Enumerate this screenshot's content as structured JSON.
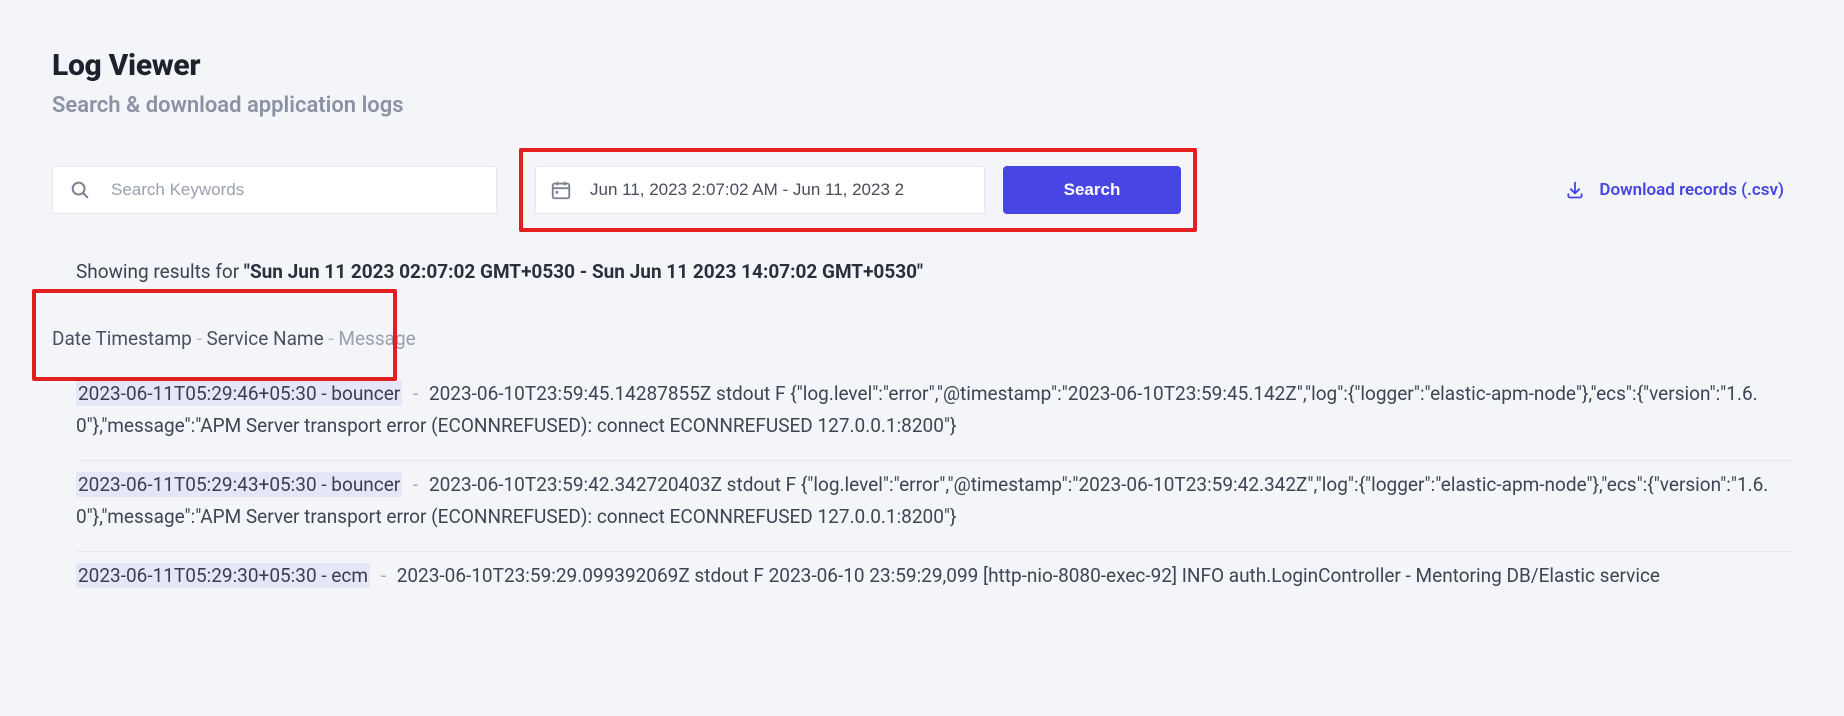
{
  "page": {
    "title": "Log Viewer",
    "subtitle": "Search & download application logs"
  },
  "search": {
    "placeholder": "Search Keywords",
    "value": ""
  },
  "dateRange": {
    "value": "Jun 11, 2023 2:07:02 AM - Jun 11, 2023 2"
  },
  "searchButton": "Search",
  "download": {
    "label": "Download records (.csv)"
  },
  "results": {
    "showingPrefix": "Showing results for ",
    "rangeText": "\"Sun Jun 11 2023 02:07:02 GMT+0530 - Sun Jun 11 2023 14:07:02 GMT+0530\"",
    "columns": {
      "timestamp": "Date Timestamp",
      "service": "Service Name",
      "message": "Message"
    },
    "logs": [
      {
        "prefix": "2023-06-11T05:29:46+05:30 - bouncer",
        "body": "2023-06-10T23:59:45.14287855Z stdout F {\"log.level\":\"error\",\"@timestamp\":\"2023-06-10T23:59:45.142Z\",\"log\":{\"logger\":\"elastic-apm-node\"},\"ecs\":{\"version\":\"1.6.0\"},\"message\":\"APM Server transport error (ECONNREFUSED): connect ECONNREFUSED 127.0.0.1:8200\"}"
      },
      {
        "prefix": "2023-06-11T05:29:43+05:30 - bouncer",
        "body": "2023-06-10T23:59:42.342720403Z stdout F {\"log.level\":\"error\",\"@timestamp\":\"2023-06-10T23:59:42.342Z\",\"log\":{\"logger\":\"elastic-apm-node\"},\"ecs\":{\"version\":\"1.6.0\"},\"message\":\"APM Server transport error (ECONNREFUSED): connect ECONNREFUSED 127.0.0.1:8200\"}"
      },
      {
        "prefix": "2023-06-11T05:29:30+05:30 - ecm",
        "body": "2023-06-10T23:59:29.099392069Z stdout F 2023-06-10 23:59:29,099 [http-nio-8080-exec-92] INFO auth.LoginController - Mentoring DB/Elastic service"
      }
    ]
  }
}
